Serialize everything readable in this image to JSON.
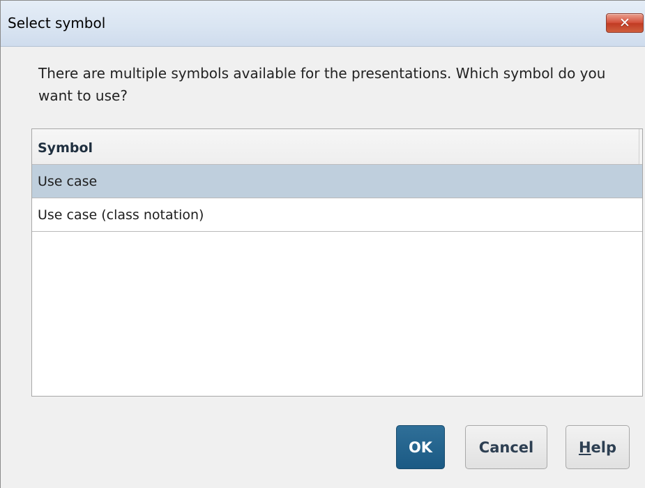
{
  "window": {
    "title": "Select symbol",
    "close_label": "✕"
  },
  "message": {
    "text": "There are multiple symbols available for the presentations. Which symbol do you want to use?"
  },
  "symbol_list": {
    "header": "Symbol",
    "items": [
      {
        "label": "Use case",
        "selected": true
      },
      {
        "label": "Use case (class notation)",
        "selected": false
      }
    ]
  },
  "buttons": {
    "ok": "OK",
    "cancel": "Cancel",
    "help_mnemonic": "H",
    "help_rest": "elp"
  },
  "colors": {
    "selected_row": "#bfcfdd",
    "ok_button": "#1b5a84",
    "close_button": "#c23b23"
  },
  "icons": {
    "close": "close-icon"
  }
}
